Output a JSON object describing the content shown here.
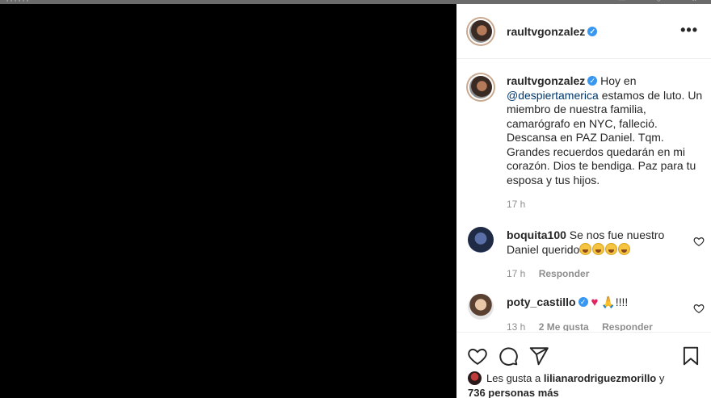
{
  "browser": {
    "faded_title": "~ ; , ; , ; ,",
    "faded_icons": "— ○ ×"
  },
  "post": {
    "author": "raultvgonzalez",
    "more_label": "•••"
  },
  "caption": {
    "username": "raultvgonzalez",
    "prefix": "Hoy en",
    "mention": "@despiertamerica",
    "body": "estamos de luto. Un miembro de nuestra familia, camarógrafo en NYC, falleció. Descansa en PAZ Daniel. Tqm. Grandes recuerdos quedarán en mi corazón. Dios te bendiga. Paz para tu esposa y tus hijos.",
    "time": "17 h"
  },
  "comments": [
    {
      "username": "boquita100",
      "text": "Se nos fue nuestro Daniel querido",
      "emoji_count": 4,
      "time": "17 h",
      "likes": "",
      "reply_label": "Responder"
    },
    {
      "username": "poty_castillo",
      "text": "!!!!",
      "time": "13 h",
      "likes": "2 Me gusta",
      "reply_label": "Responder"
    }
  ],
  "likes": {
    "prefix": "Les gusta a",
    "user": "lilianarodriguezmorillo",
    "conjunction": "y",
    "others": "736 personas más"
  },
  "colors": {
    "verified": "#3897f0",
    "mention": "#00376b",
    "meta": "#8e8e8e",
    "media": "#000000"
  }
}
